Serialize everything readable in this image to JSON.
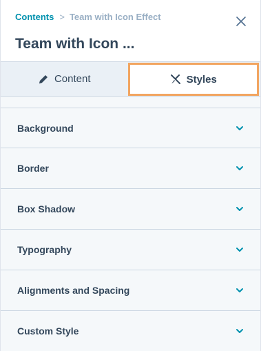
{
  "header": {
    "breadcrumb_link": "Contents",
    "breadcrumb_separator": ">",
    "breadcrumb_current": "Team with Icon Effect",
    "title": "Team with Icon ..."
  },
  "tabs": [
    {
      "label": "Content",
      "icon": "pencil-icon",
      "active": false
    },
    {
      "label": "Styles",
      "icon": "brush-icon",
      "active": true
    }
  ],
  "sections": [
    {
      "label": "Background"
    },
    {
      "label": "Border"
    },
    {
      "label": "Box Shadow"
    },
    {
      "label": "Typography"
    },
    {
      "label": "Alignments and Spacing"
    },
    {
      "label": "Custom Style"
    }
  ],
  "colors": {
    "link": "#0091ae",
    "muted": "#99afc4",
    "text": "#33475b",
    "highlight": "#f2a561",
    "chevron": "#0091ae"
  }
}
